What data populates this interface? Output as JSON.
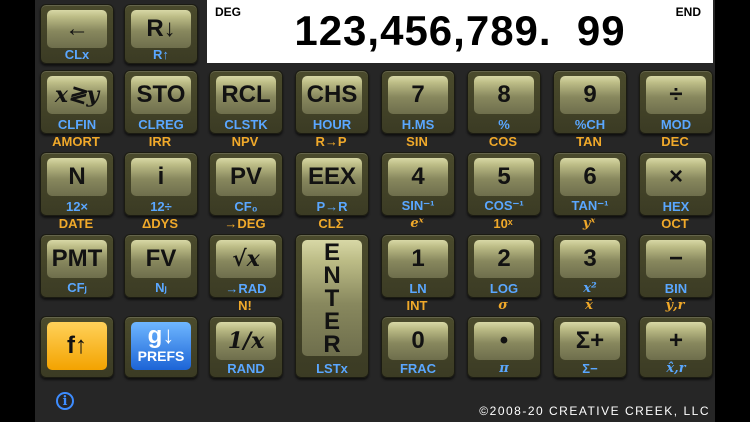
{
  "display": {
    "mode_left": "DEG",
    "mode_right": "END",
    "value": "123,456,789.  99"
  },
  "keys": {
    "backspace": {
      "main": "←",
      "g": "CLx"
    },
    "rdown": {
      "main": "R↓",
      "g": "R↑"
    },
    "xy": {
      "main": "x≷y",
      "g": "CLFIN",
      "f": "AMORT"
    },
    "sto": {
      "main": "STO",
      "g": "CLREG",
      "f": "IRR"
    },
    "rcl": {
      "main": "RCL",
      "g": "CLSTK",
      "f": "NPV"
    },
    "chs": {
      "main": "CHS",
      "g": "HOUR",
      "f": "R→P"
    },
    "k7": {
      "main": "7",
      "g": "H.MS",
      "f": "SIN"
    },
    "k8": {
      "main": "8",
      "g": "%",
      "f": "COS"
    },
    "k9": {
      "main": "9",
      "g": "%CH",
      "f": "TAN"
    },
    "div": {
      "main": "÷",
      "g": "MOD",
      "f": "DEC"
    },
    "n": {
      "main": "N",
      "g": "12×",
      "f": "DATE"
    },
    "i": {
      "main": "i",
      "g": "12÷",
      "f": "ΔDYS"
    },
    "pv": {
      "main": "PV",
      "g": "CF₀",
      "f": "→DEG"
    },
    "eex": {
      "main": "EEX",
      "g": "P→R",
      "f": "CLΣ"
    },
    "k4": {
      "main": "4",
      "g": "SIN⁻¹",
      "f": "eˣ"
    },
    "k5": {
      "main": "5",
      "g": "COS⁻¹",
      "f": "10ˣ"
    },
    "k6": {
      "main": "6",
      "g": "TAN⁻¹",
      "f": "yˣ"
    },
    "mul": {
      "main": "×",
      "g": "HEX",
      "f": "OCT"
    },
    "pmt": {
      "main": "PMT",
      "g": "CFⱼ"
    },
    "fv": {
      "main": "FV",
      "g": "Nⱼ"
    },
    "sqrt": {
      "main": "√x",
      "g": "→RAD",
      "f": "N!"
    },
    "enter": {
      "letters": [
        "E",
        "N",
        "T",
        "E",
        "R"
      ],
      "g": "LSTx"
    },
    "k1": {
      "main": "1",
      "g": "LN",
      "f": "INT"
    },
    "k2": {
      "main": "2",
      "g": "LOG",
      "f": "σ"
    },
    "k3": {
      "main": "3",
      "g": "x²",
      "f": "x̄"
    },
    "sub": {
      "main": "−",
      "g": "BIN",
      "f": "ŷ,r"
    },
    "fkey": {
      "main": "f↑"
    },
    "gkey": {
      "main": "g↓",
      "sub": "PREFS"
    },
    "recip": {
      "main": "1/x",
      "g": "RAND"
    },
    "k0": {
      "main": "0",
      "g": "FRAC"
    },
    "dot": {
      "main": "•",
      "g": "π"
    },
    "sigma": {
      "main": "Σ+",
      "g": "Σ−"
    },
    "add": {
      "main": "+",
      "g": "x̂,r"
    }
  },
  "footer": {
    "info_icon": "i",
    "copyright": "©2008-20 CREATIVE CREEK, LLC"
  },
  "colors": {
    "f_label": "#f0a92a",
    "g_label": "#5aa7ff",
    "key_face": "#a3a372",
    "display_bg": "#ffffff"
  }
}
